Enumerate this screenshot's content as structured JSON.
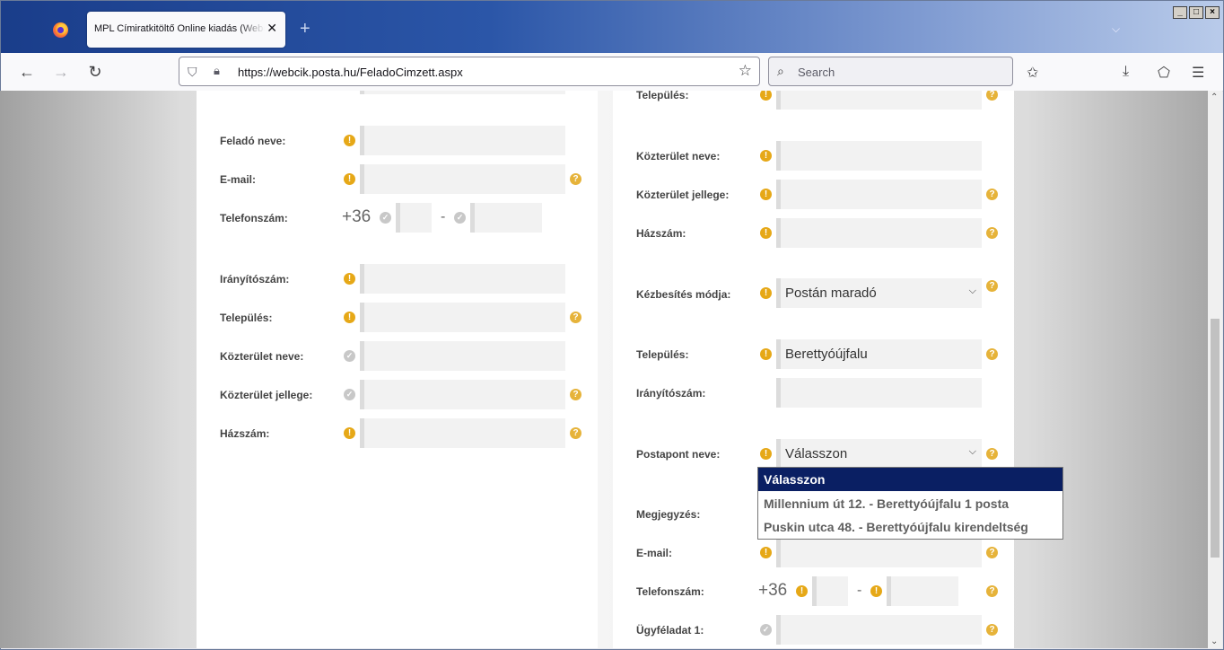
{
  "browser": {
    "tab_title": "MPL Címiratkitöltő Online kiadás (Webcik)",
    "url": "https://webcik.posta.hu/FeladoCimzett.aspx",
    "search_placeholder": "Search",
    "window_buttons": [
      "_",
      "□",
      "×"
    ]
  },
  "left_panel": {
    "sender_name_label": "Feladó neve:",
    "email_label": "E-mail:",
    "phone_label": "Telefonszám:",
    "phone_prefix": "+36",
    "phone_dash": "-",
    "zip_label": "Irányítószám:",
    "city_label": "Település:",
    "street_name_label": "Közterület neve:",
    "street_type_label": "Közterület jellege:",
    "house_number_label": "Házszám:"
  },
  "right_panel": {
    "city_label_top": "Település:",
    "street_name_label": "Közterület neve:",
    "street_type_label": "Közterület jellege:",
    "house_number_label": "Házszám:",
    "delivery_mode_label": "Kézbesítés módja:",
    "delivery_mode_value": "Postán maradó",
    "city_label": "Település:",
    "city_value": "Berettyóújfalu",
    "zip_label": "Irányítószám:",
    "postpoint_label": "Postapont neve:",
    "postpoint_value": "Válasszon",
    "note_label": "Megjegyzés:",
    "email_label": "E-mail:",
    "phone_label": "Telefonszám:",
    "phone_prefix": "+36",
    "phone_dash": "-",
    "client_data_label": "Ügyféladat 1:"
  },
  "postpoint_dropdown": {
    "options": [
      "Válasszon",
      "Millennium út 12. - Berettyóújfalu 1 posta",
      "Puskin utca 48. - Berettyóújfalu kirendeltség"
    ],
    "selected_index": 0
  },
  "icons": {
    "required": "!",
    "help": "?",
    "ok": "✓"
  },
  "colors": {
    "required_icon": "#e6a817",
    "help_icon": "#e6b33a",
    "dropdown_selected_bg": "#0a1f63"
  }
}
